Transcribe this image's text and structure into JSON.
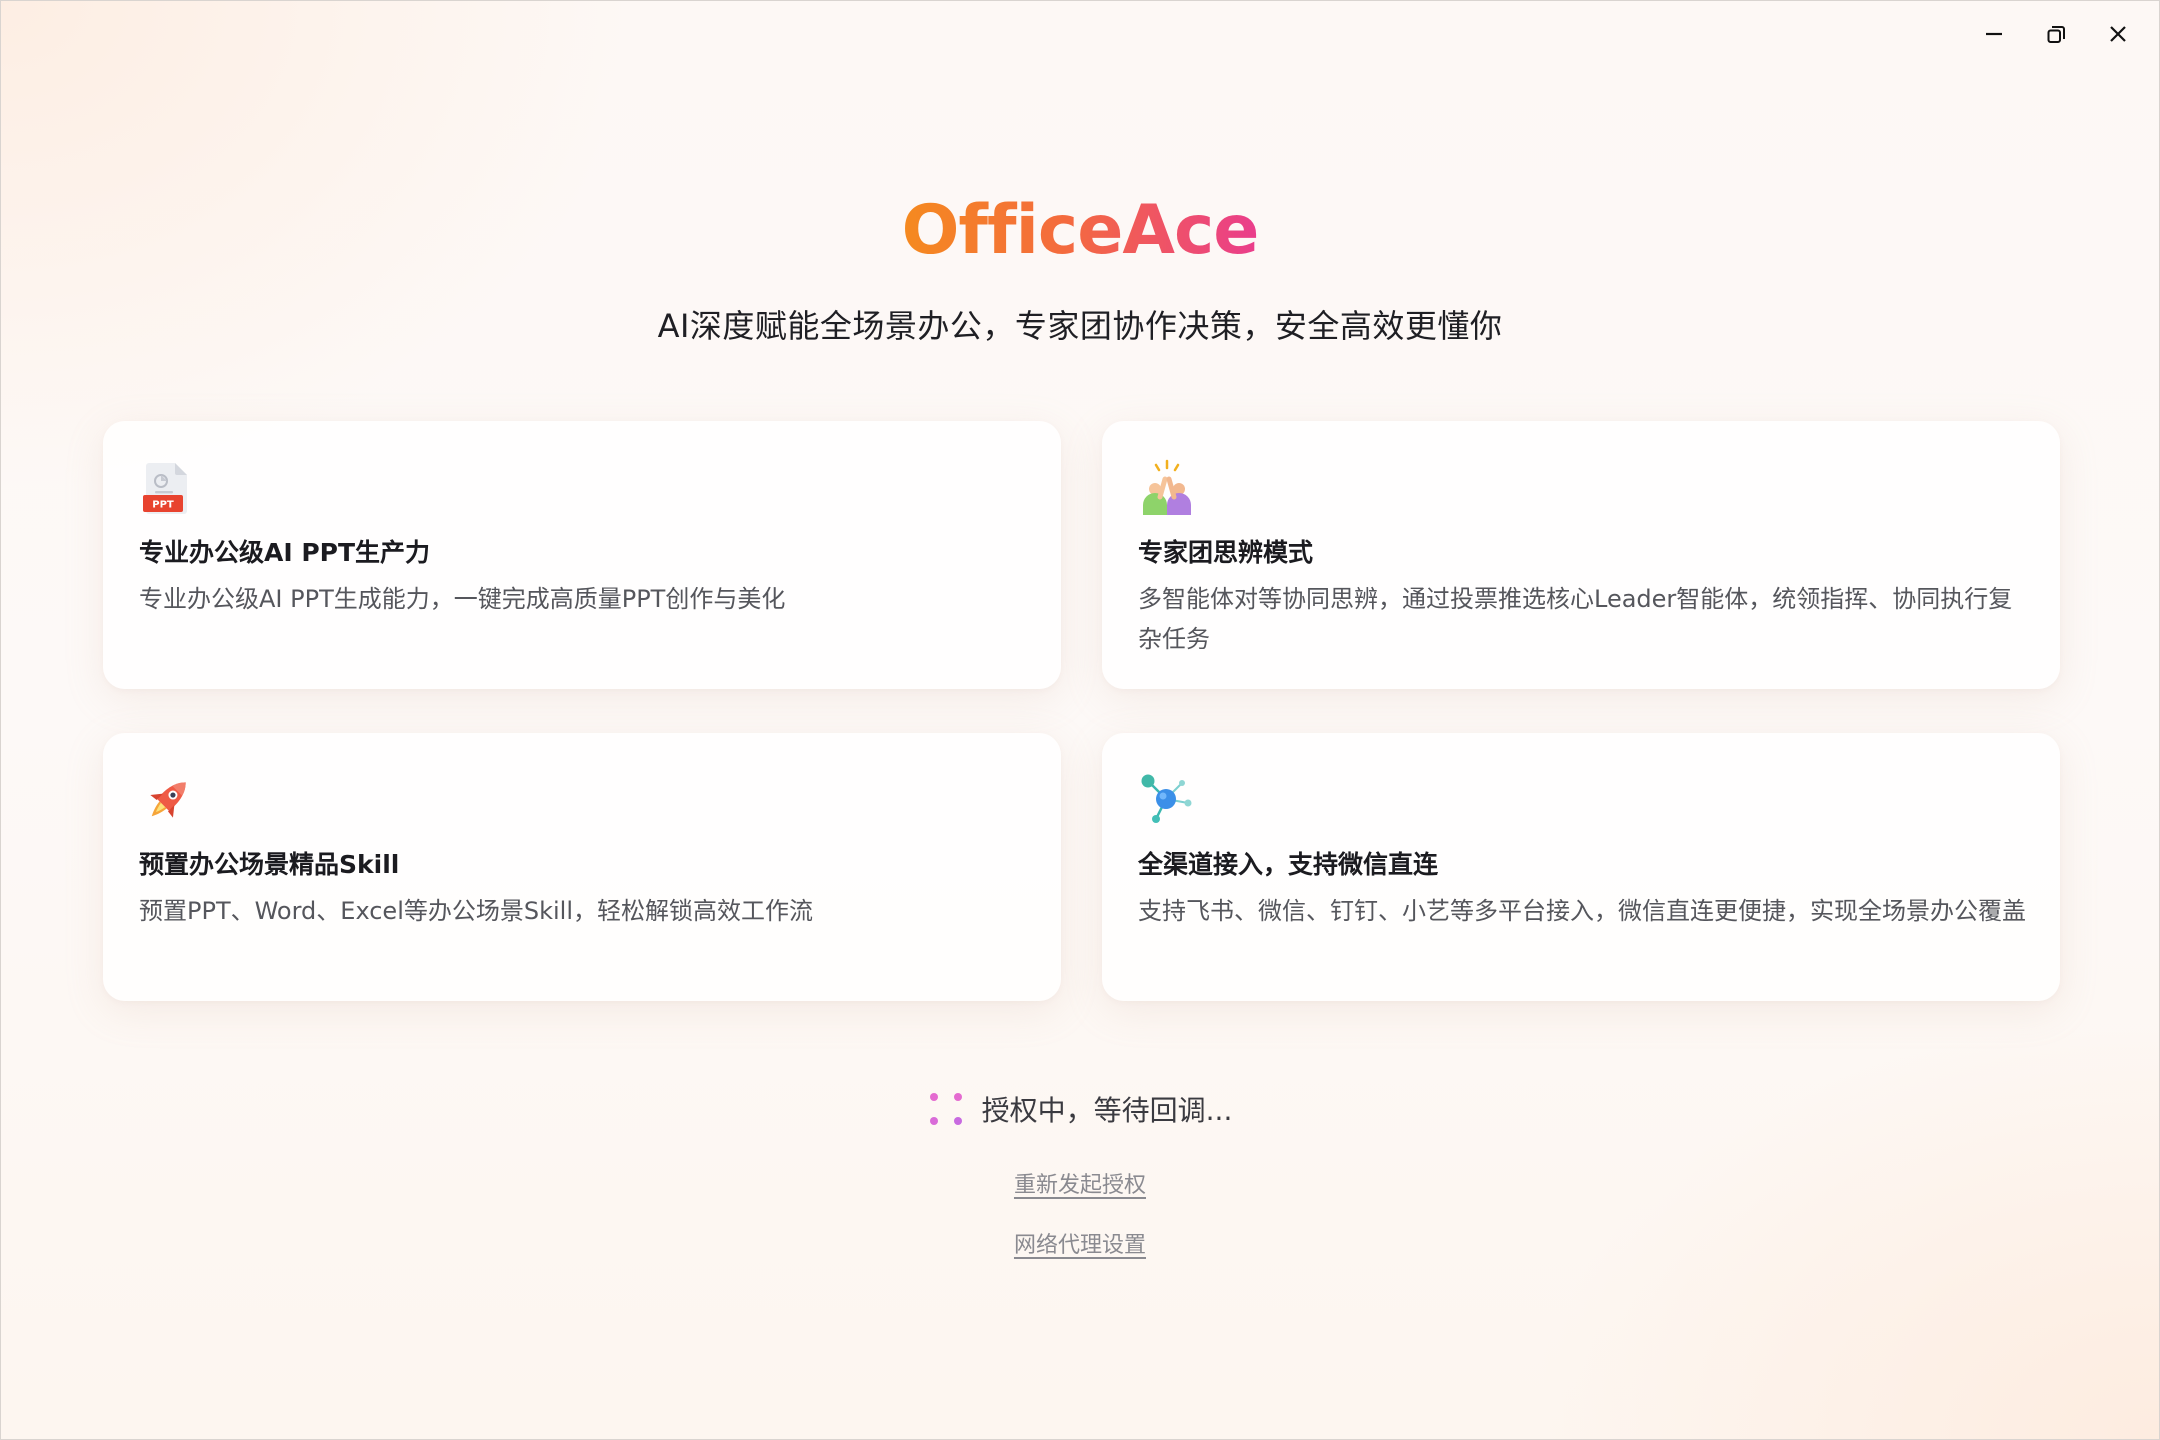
{
  "window": {
    "controls": {
      "minimize": "minimize-icon",
      "maximize": "restore-icon",
      "close": "close-icon"
    }
  },
  "brand": {
    "logo": "OfficeAce",
    "tagline": "AI深度赋能全场景办公，专家团协作决策，安全高效更懂你",
    "gradient": [
      "#f58a1f",
      "#ea3d8c"
    ]
  },
  "features": [
    {
      "icon": "ppt-file-icon",
      "title": "专业办公级AI PPT生产力",
      "desc": "专业办公级AI PPT生成能力，一键完成高质量PPT创作与美化"
    },
    {
      "icon": "expert-team-icon",
      "title": "专家团思辨模式",
      "desc": "多智能体对等协同思辨，通过投票推选核心Leader智能体，统领指挥、协同执行复杂任务"
    },
    {
      "icon": "rocket-icon",
      "title": "预置办公场景精品Skill",
      "desc": "预置PPT、Word、Excel等办公场景Skill，轻松解锁高效工作流"
    },
    {
      "icon": "network-hub-icon",
      "title": "全渠道接入，支持微信直连",
      "desc": "支持飞书、微信、钉钉、小艺等多平台接入，微信直连更便捷，实现全场景办公覆盖"
    }
  ],
  "status": {
    "text": "授权中，等待回调...",
    "spinner_color": "#e05cc8"
  },
  "links": {
    "reauthorize": "重新发起授权",
    "proxy_settings": "网络代理设置"
  }
}
